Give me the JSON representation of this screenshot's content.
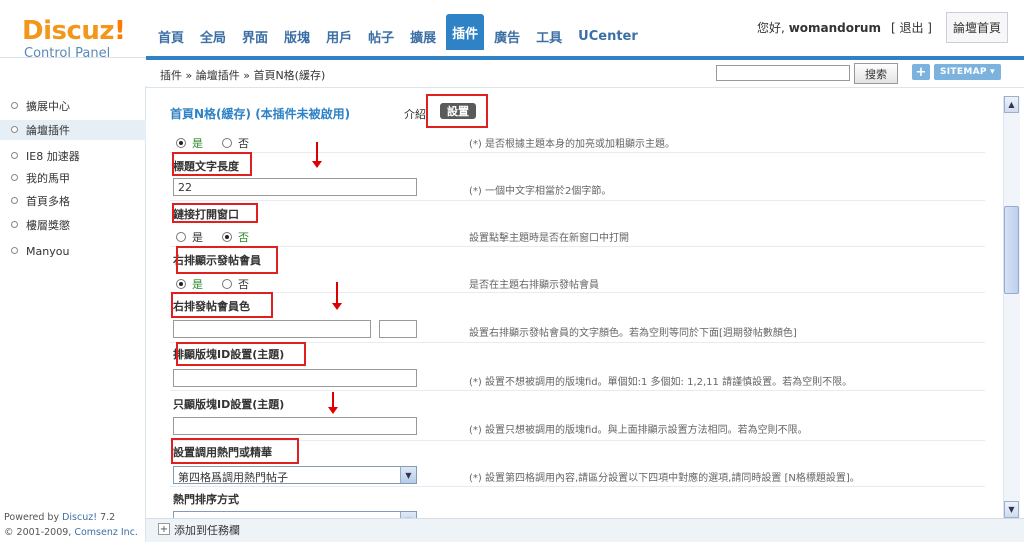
{
  "logo": {
    "brand": "Discuz",
    "bang": "!",
    "subtitle": "Control Panel"
  },
  "nav": {
    "tabs": [
      "首頁",
      "全局",
      "界面",
      "版塊",
      "用戶",
      "帖子",
      "擴展",
      "插件",
      "廣告",
      "工具",
      "UCenter"
    ],
    "active": "插件"
  },
  "user": {
    "greeting": "您好,",
    "name": "womandorum",
    "logout": "[ 退出 ]",
    "home": "論壇首頁"
  },
  "breadcrumb": "插件 » 論壇插件 » 首頁N格(緩存)",
  "search": {
    "button": "搜索",
    "plus": "+",
    "sitemap": "SITEMAP ▾"
  },
  "sidebar": {
    "items": [
      "擴展中心",
      "論壇插件",
      "IE8 加速器",
      "我的馬甲",
      "首頁多格",
      "樓層獎懲",
      "Manyou"
    ],
    "active": "論壇插件",
    "footer_line1_prefix": "Powered by ",
    "footer_line1_brand": "Discuz!",
    "footer_line1_ver": " 7.2",
    "footer_line2_prefix": "© 2001-2009, ",
    "footer_line2_brand": "Comsenz Inc."
  },
  "main": {
    "title": "首頁N格(緩存) (本插件未被啟用)",
    "tab_intro": "介紹",
    "tab_settings": "設置"
  },
  "form": {
    "row0": {
      "yes": "是",
      "no": "否",
      "hint": "(*) 是否根據主題本身的加亮或加粗顯示主題。"
    },
    "row1": {
      "label": "標題文字長度",
      "value": "22",
      "hint": "(*) 一個中文字相當於2個字節。"
    },
    "row2": {
      "label": "鏈接打開窗口",
      "yes": "是",
      "no": "否",
      "hint": "設置點擊主題時是否在新窗口中打開"
    },
    "row3": {
      "label": "右排顯示發帖會員",
      "yes": "是",
      "no": "否",
      "hint": "是否在主題右排顯示發帖會員"
    },
    "row4": {
      "label": "右排發帖會員色",
      "hint": "設置右排顯示發帖會員的文字顏色。若為空則等同於下面[週期發帖數顏色]"
    },
    "row5": {
      "label": "排顯版塊ID設置(主題)",
      "hint": "(*) 設置不想被調用的版塊fid。單個如:1 多個如: 1,2,11 請謹慎設置。若為空則不限。"
    },
    "row6": {
      "label": "只顯版塊ID設置(主題)",
      "hint": "(*) 設置只想被調用的版塊fid。與上面排顯示設置方法相同。若為空則不限。"
    },
    "row7": {
      "label": "設置調用熱門或精華",
      "value": "第四格爲調用熱門帖子",
      "hint": "(*) 設置第四格調用內容,請區分設置以下四項中對應的選項,請同時設置 [N格標題設置]。"
    },
    "row8": {
      "label": "熱門排序方式"
    }
  },
  "bottom": {
    "plus": "+",
    "label": "添加到任務欄"
  },
  "scroll": {
    "up": "▲",
    "down": "▼"
  }
}
